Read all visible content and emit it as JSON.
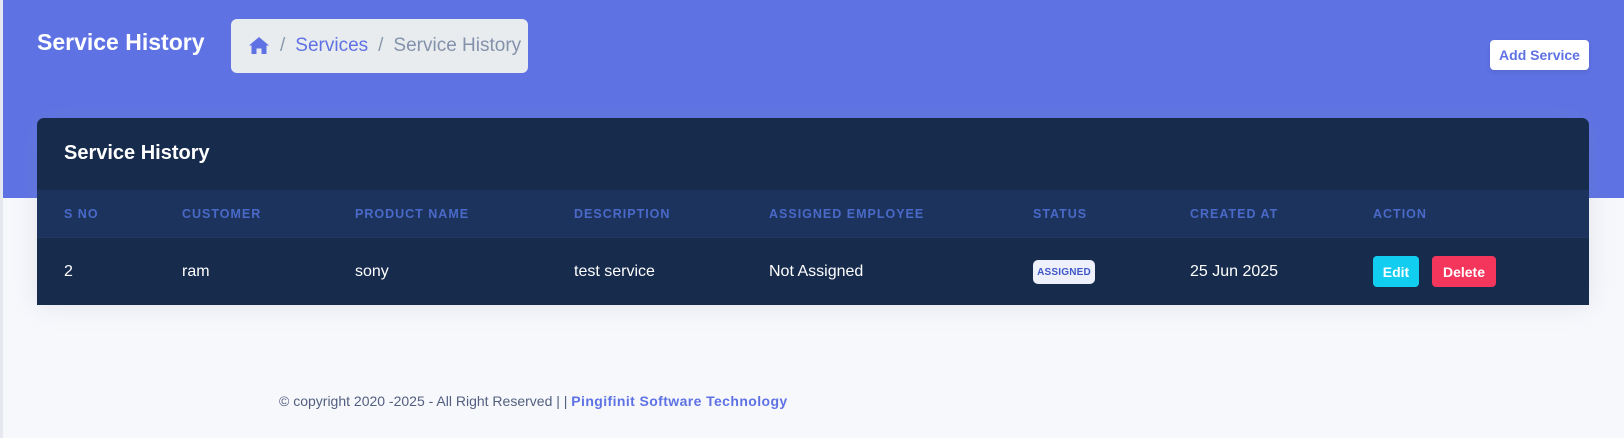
{
  "page": {
    "title": "Service History",
    "colors": {
      "header": "#5e72e4",
      "card": "#172b4d",
      "edit": "#11cdef",
      "delete": "#f5365c"
    }
  },
  "breadcrumb": {
    "home_icon": "home-icon",
    "separator": "/",
    "items": [
      {
        "label": "Services"
      },
      {
        "label": "Service History"
      }
    ]
  },
  "actions": {
    "add_service_label": "Add Service"
  },
  "card": {
    "title": "Service History",
    "columns": [
      "S NO",
      "CUSTOMER",
      "PRODUCT NAME",
      "DESCRIPTION",
      "ASSIGNED EMPLOYEE",
      "STATUS",
      "CREATED AT",
      "ACTION"
    ],
    "rows": [
      {
        "sno": "2",
        "customer": "ram",
        "product": "sony",
        "description": "test service",
        "employee": "Not Assigned",
        "status": "ASSIGNED",
        "created_at": "25 Jun 2025",
        "edit_label": "Edit",
        "delete_label": "Delete"
      }
    ]
  },
  "footer": {
    "text": "© copyright 2020 -2025 - All Right Reserved | |",
    "company": "Pingifinit Software Technology"
  }
}
